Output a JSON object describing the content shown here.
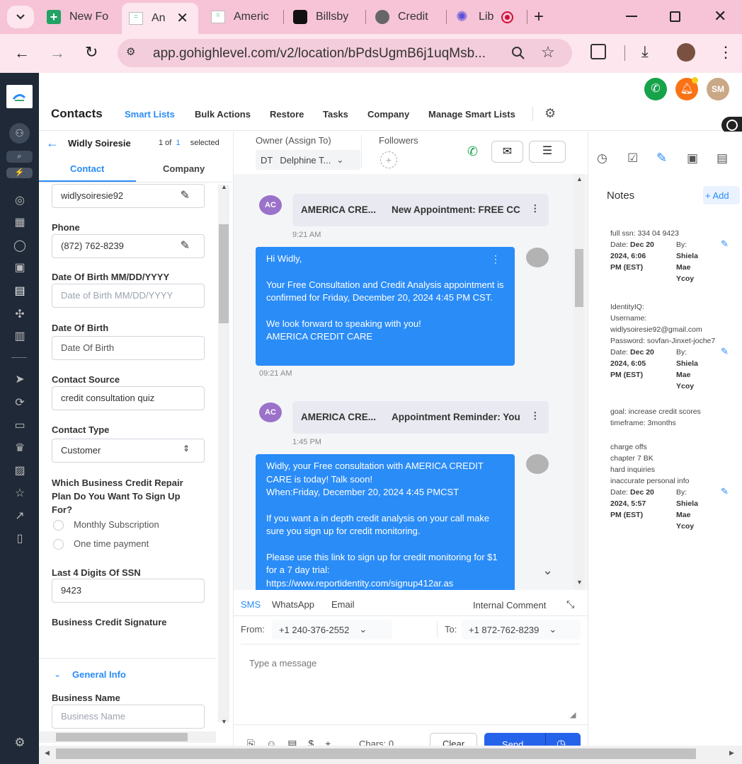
{
  "browser": {
    "tabs": [
      {
        "label": "New Fo",
        "icon": "plus-doc-icon"
      },
      {
        "label": "An",
        "icon": "gohighlevel-icon"
      },
      {
        "label": "Americ",
        "icon": "gohighlevel-icon"
      },
      {
        "label": "Billsby",
        "icon": "billsby-icon"
      },
      {
        "label": "Credit",
        "icon": "globe-icon"
      },
      {
        "label": "Lib",
        "icon": "gear-flower-icon"
      }
    ],
    "url": "app.gohighlevel.com/v2/location/bPdsUgmB6j1uqMsb..."
  },
  "header": {
    "title": "Contacts",
    "tabs": [
      "Smart Lists",
      "Bulk Actions",
      "Restore",
      "Tasks",
      "Company",
      "Manage Smart Lists"
    ],
    "user_initials": "SM"
  },
  "contact": {
    "name": "Widly Soiresie",
    "pager_of": "1 of",
    "pager_num": "1",
    "pager_selected": "selected",
    "tab_contact": "Contact",
    "tab_company": "Company",
    "username_value": "widlysoiresie92",
    "phone_label": "Phone",
    "phone_value": "(872) 762-8239",
    "dob_mm_label": "Date Of Birth MM/DD/YYYY",
    "dob_mm_placeholder": "Date of Birth MM/DD/YYYY",
    "dob_label": "Date Of Birth",
    "dob_placeholder": "Date Of Birth",
    "source_label": "Contact Source",
    "source_value": "credit consultation quiz",
    "type_label": "Contact Type",
    "type_value": "Customer",
    "plan_label": "Which Business Credit Repair Plan Do You Want To Sign Up For?",
    "plan_option_1": "Monthly Subscription",
    "plan_option_2": "One time payment",
    "ssn_label": "Last 4 Digits Of SSN",
    "ssn_value": "9423",
    "signature_label": "Business Credit Signature",
    "general_info": "General Info",
    "business_name_label": "Business Name",
    "business_name_placeholder": "Business Name"
  },
  "conversation": {
    "owner_label": "Owner (Assign To)",
    "owner_initials": "DT",
    "owner_name": "Delphine T...",
    "followers_label": "Followers",
    "messages": [
      {
        "avatar": "AC",
        "sender": "AMERICA CRE...",
        "subject": "New Appointment: FREE CC",
        "time": "9:21 AM"
      },
      {
        "lines": [
          "Hi Widly,",
          "",
          "Your Free Consultation and Credit Analysis appointment is confirmed for Friday, December 20, 2024 4:45 PM CST.",
          "",
          "We look forward to speaking with you!",
          "AMERICA CREDIT CARE"
        ],
        "time": "09:21 AM"
      },
      {
        "avatar": "AC",
        "sender": "AMERICA CRE...",
        "subject": "Appointment Reminder: You",
        "time": "1:45 PM"
      },
      {
        "lines": [
          "Widly, your Free consultation with AMERICA CREDIT CARE is today! Talk soon!",
          "When:Friday, December 20, 2024 4:45 PMCST",
          "",
          "If you want a in depth credit analysis on your call make sure you sign up for credit monitoring.",
          "",
          "Please use this link to sign up for credit monitoring for $1 for a 7 day trial:",
          "https://www.reportidentity.com/signup412ar.as"
        ]
      }
    ],
    "composer": {
      "channels": [
        "SMS",
        "WhatsApp",
        "Email"
      ],
      "internal_comment": "Internal Comment",
      "from_label": "From:",
      "from_value": "+1 240-376-2552",
      "to_label": "To:",
      "to_value": "+1 872-762-8239",
      "placeholder": "Type a message",
      "chars": "Chars: 0,",
      "clear": "Clear",
      "send": "Send"
    }
  },
  "notes": {
    "title": "Notes",
    "add": "+ Add",
    "by_label": "By:",
    "items": [
      {
        "lines": [
          "full ssn: 334 04 9423"
        ],
        "date_label": "Date:",
        "date_lines": [
          "Dec 20",
          "2024, 6:06",
          "PM (EST)"
        ],
        "by_lines": [
          "Shiela",
          "Mae",
          "Ycoy"
        ]
      },
      {
        "lines": [
          "IdentityIQ:",
          "Username:",
          "widlysoiresie92@gmail.com",
          "Password: sovfan-Jinxet-joche7"
        ],
        "date_label": "Date:",
        "date_lines": [
          "Dec 20",
          "2024, 6:05",
          "PM (EST)"
        ],
        "by_lines": [
          "Shiela",
          "Mae",
          "Ycoy"
        ]
      },
      {
        "lines": [
          "goal: increase credit scores",
          "timeframe: 3months"
        ]
      },
      {
        "lines": [
          "charge offs",
          "chapter 7 BK",
          "hard inquiries",
          "inaccurate personal info"
        ],
        "date_label": "Date:",
        "date_lines": [
          "Dec 20",
          "2024, 5:57",
          "PM (EST)"
        ],
        "by_lines": [
          "Shiela",
          "Mae",
          "Ycoy"
        ]
      }
    ]
  },
  "colors": {
    "accent": "#2a8cf7",
    "nav_bg": "#1f2937",
    "tab_bar": "#f6c4d6"
  }
}
